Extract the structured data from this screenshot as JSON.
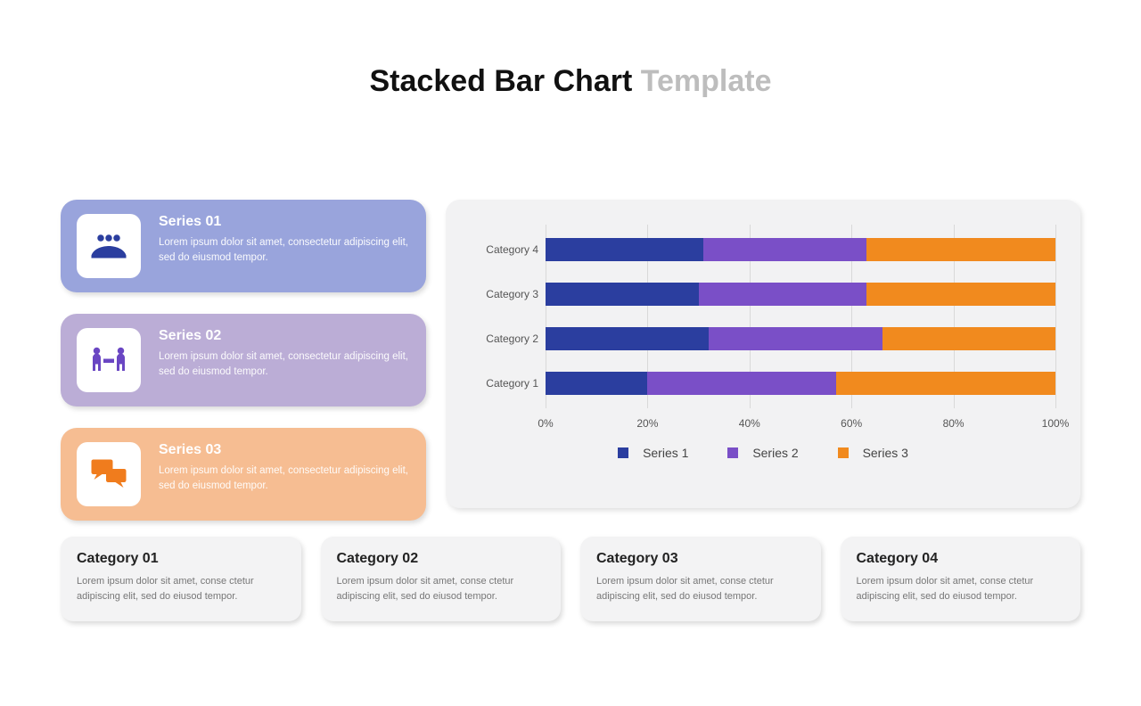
{
  "title_main": "Stacked Bar Chart",
  "title_sub": "Template",
  "series_cards": [
    {
      "title": "Series 01",
      "desc": "Lorem ipsum dolor sit amet, consectetur adipiscing elit, sed do eiusmod tempor."
    },
    {
      "title": "Series 02",
      "desc": "Lorem ipsum dolor sit amet, consectetur adipiscing elit, sed do eiusmod tempor."
    },
    {
      "title": "Series 03",
      "desc": "Lorem ipsum dolor sit amet, consectetur adipiscing elit, sed do eiusmod tempor."
    }
  ],
  "category_cards": [
    {
      "title": "Category 01",
      "desc": "Lorem ipsum dolor sit amet, conse ctetur adipiscing elit, sed do eiusod tempor."
    },
    {
      "title": "Category 02",
      "desc": "Lorem ipsum dolor sit amet, conse ctetur adipiscing elit, sed do eiusod tempor."
    },
    {
      "title": "Category 03",
      "desc": "Lorem ipsum dolor sit amet, conse ctetur adipiscing elit, sed do eiusod tempor."
    },
    {
      "title": "Category 04",
      "desc": "Lorem ipsum dolor sit amet, conse ctetur adipiscing elit, sed do eiusod tempor."
    }
  ],
  "legend": {
    "s1": "Series 1",
    "s2": "Series 2",
    "s3": "Series 3"
  },
  "colors": {
    "series1": "#2b3e9f",
    "series2": "#7a4fc7",
    "series3": "#f18a1e"
  },
  "chart_data": {
    "type": "bar",
    "orientation": "horizontal-stacked",
    "categories": [
      "Category 1",
      "Category 2",
      "Category 3",
      "Category 4"
    ],
    "series": [
      {
        "name": "Series 1",
        "values": [
          20,
          32,
          30,
          31
        ]
      },
      {
        "name": "Series 2",
        "values": [
          37,
          34,
          33,
          32
        ]
      },
      {
        "name": "Series 3",
        "values": [
          43,
          34,
          37,
          37
        ]
      }
    ],
    "xlabel": "",
    "ylabel": "",
    "xlim": [
      0,
      100
    ],
    "x_ticks": [
      "0%",
      "20%",
      "40%",
      "60%",
      "80%",
      "100%"
    ],
    "title": ""
  }
}
